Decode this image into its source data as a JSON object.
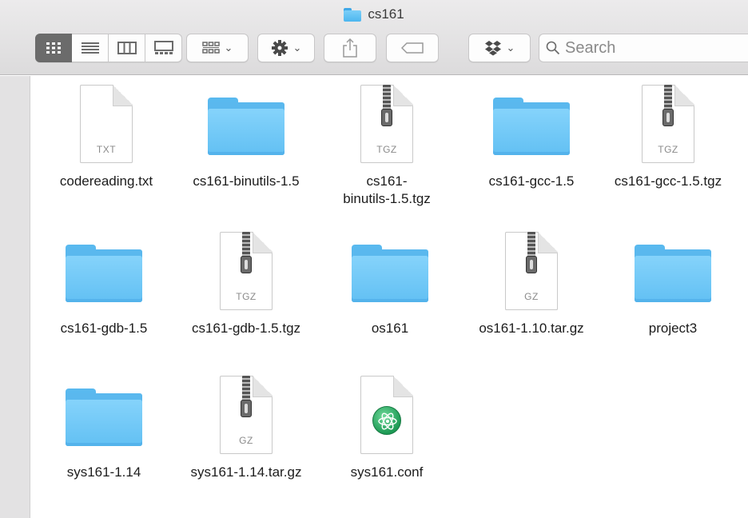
{
  "window": {
    "title": "cs161"
  },
  "toolbar": {
    "view_buttons": [
      {
        "name": "icon-view",
        "icon": "grid-icon",
        "active": true
      },
      {
        "name": "list-view",
        "icon": "list-icon",
        "active": false
      },
      {
        "name": "column-view",
        "icon": "columns-icon",
        "active": false
      },
      {
        "name": "gallery-view",
        "icon": "gallery-icon",
        "active": false
      }
    ],
    "group_by_icon": "group-by-icon",
    "action_icon": "gear-icon",
    "share_icon": "share-icon",
    "tags_icon": "tag-icon",
    "dropbox_icon": "dropbox-icon",
    "search": {
      "placeholder": "Search",
      "value": ""
    }
  },
  "files": [
    {
      "name": "codereading.txt",
      "type": "doc",
      "ext": "TXT"
    },
    {
      "name": "cs161-binutils-1.5",
      "type": "folder"
    },
    {
      "name": "cs161-\nbinutils-1.5.tgz",
      "type": "zip",
      "ext": "TGZ"
    },
    {
      "name": "cs161-gcc-1.5",
      "type": "folder"
    },
    {
      "name": "cs161-gcc-1.5.tgz",
      "type": "zip",
      "ext": "TGZ"
    },
    {
      "name": "cs161-gdb-1.5",
      "type": "folder"
    },
    {
      "name": "cs161-gdb-1.5.tgz",
      "type": "zip",
      "ext": "TGZ"
    },
    {
      "name": "os161",
      "type": "folder"
    },
    {
      "name": "os161-1.10.tar.gz",
      "type": "zip",
      "ext": "GZ"
    },
    {
      "name": "project3",
      "type": "folder"
    },
    {
      "name": "sys161-1.14",
      "type": "folder"
    },
    {
      "name": "sys161-1.14.tar.gz",
      "type": "zip",
      "ext": "GZ"
    },
    {
      "name": "sys161.conf",
      "type": "atom"
    }
  ]
}
